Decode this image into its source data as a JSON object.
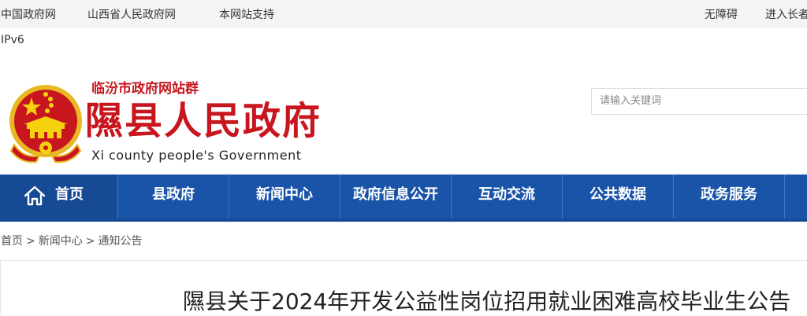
{
  "topbar": {
    "links_left": [
      "中国政府网",
      "山西省人民政府网",
      "本网站支持"
    ],
    "ipv6": "IPv6",
    "links_right": [
      "无障碍",
      "进入长者"
    ]
  },
  "header": {
    "site_group": "临汾市政府网站群",
    "site_title": "隰县人民政府",
    "site_title_en": "Xi county people's Government",
    "search_placeholder": "请输入关键词"
  },
  "nav": {
    "home": "首页",
    "items": [
      "县政府",
      "新闻中心",
      "政府信息公开",
      "互动交流",
      "公共数据",
      "政务服务"
    ]
  },
  "breadcrumb": {
    "items": [
      "首页",
      "新闻中心",
      "通知公告"
    ],
    "separator": ">"
  },
  "article": {
    "title": "隰县关于2024年开发公益性岗位招用就业困难高校毕业生公告"
  },
  "colors": {
    "brand_red": "#c8161e",
    "nav_blue": "#1a54a8",
    "nav_active": "#164a95"
  },
  "icons": {
    "emblem": "national-emblem-icon",
    "home": "home-icon"
  }
}
